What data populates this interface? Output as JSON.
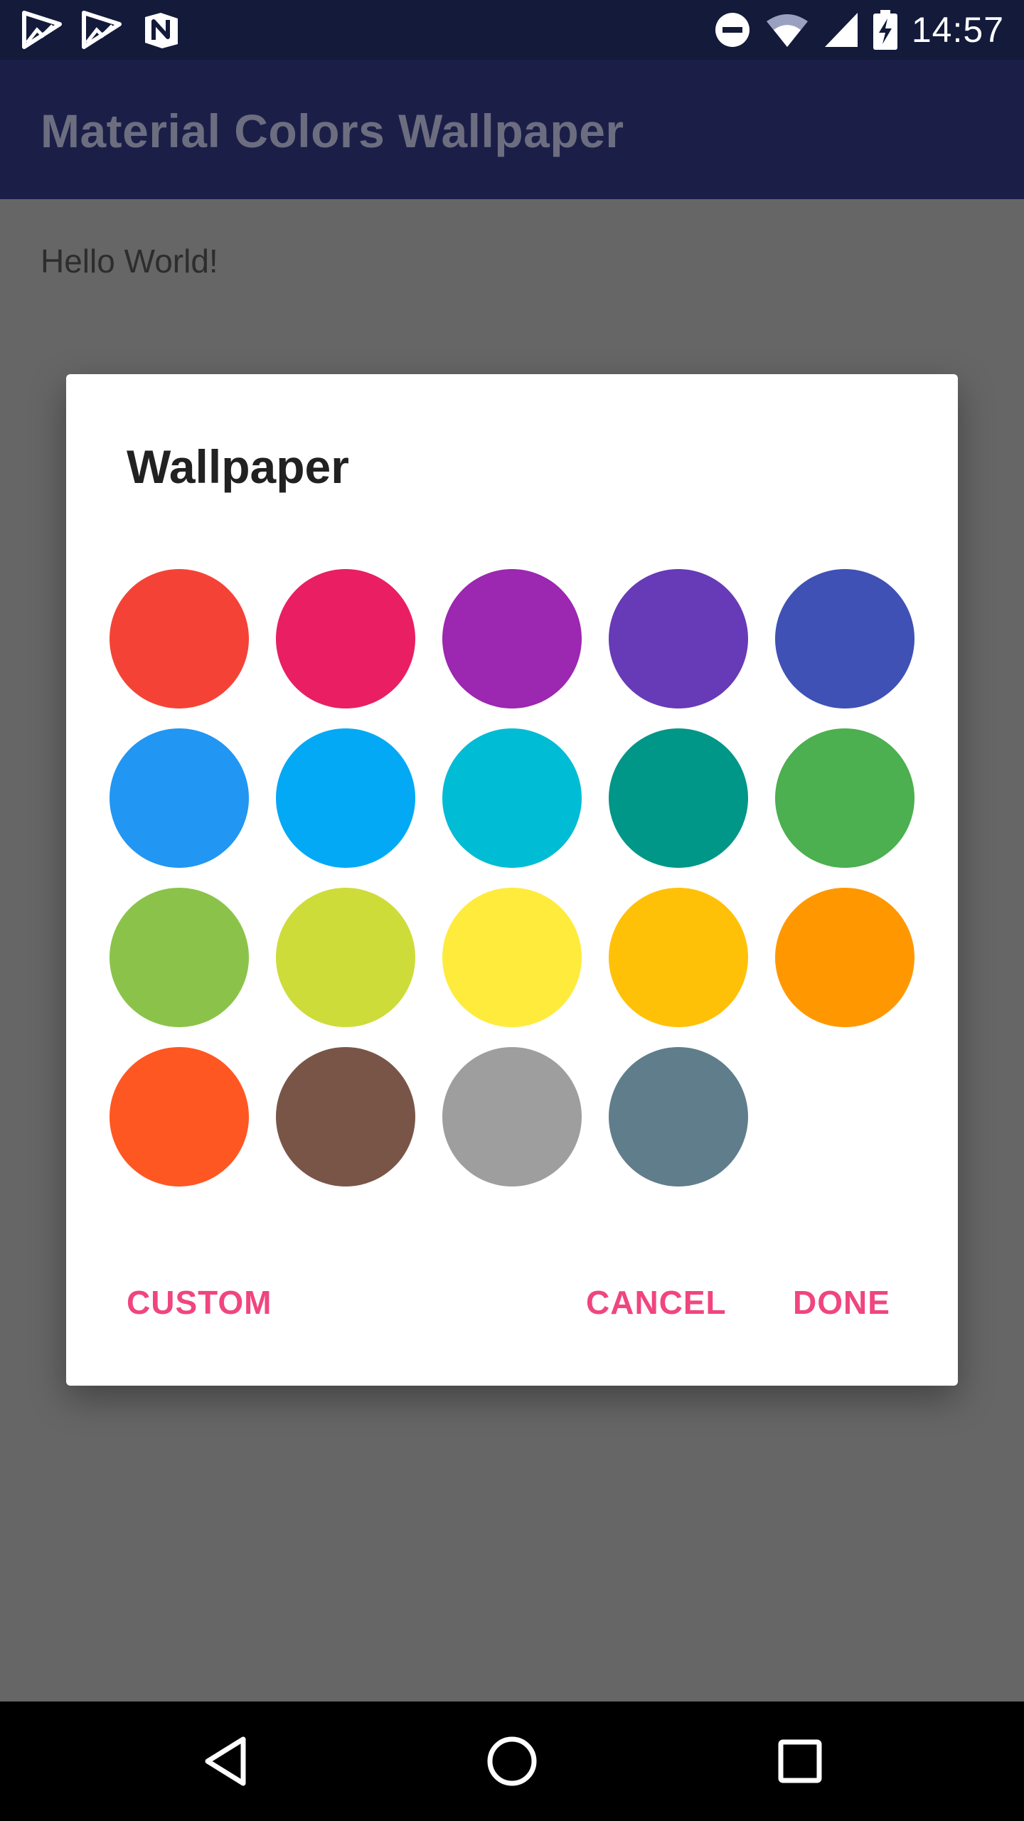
{
  "status_bar": {
    "time": "14:57",
    "icons_left": [
      "play-store-icon",
      "play-store-icon",
      "n-icon"
    ],
    "icons_right": [
      "do-not-disturb-icon",
      "wifi-icon",
      "signal-icon",
      "battery-charging-icon"
    ]
  },
  "app_bar": {
    "title": "Material Colors Wallpaper"
  },
  "content": {
    "text": "Hello World!"
  },
  "dialog": {
    "title": "Wallpaper",
    "swatches": [
      "#F44336",
      "#E91E63",
      "#9C27B0",
      "#673AB7",
      "#3F51B5",
      "#2196F3",
      "#03A9F4",
      "#00BCD4",
      "#009688",
      "#4CAF50",
      "#8BC34A",
      "#CDDC39",
      "#FFEB3B",
      "#FFC107",
      "#FF9800",
      "#FF5722",
      "#795548",
      "#9E9E9E",
      "#607D8B"
    ],
    "buttons": {
      "custom": "CUSTOM",
      "cancel": "CANCEL",
      "done": "DONE"
    },
    "button_color": "#F0457E"
  },
  "nav_bar": {
    "icons": [
      "back-icon",
      "home-icon",
      "recents-icon"
    ]
  }
}
